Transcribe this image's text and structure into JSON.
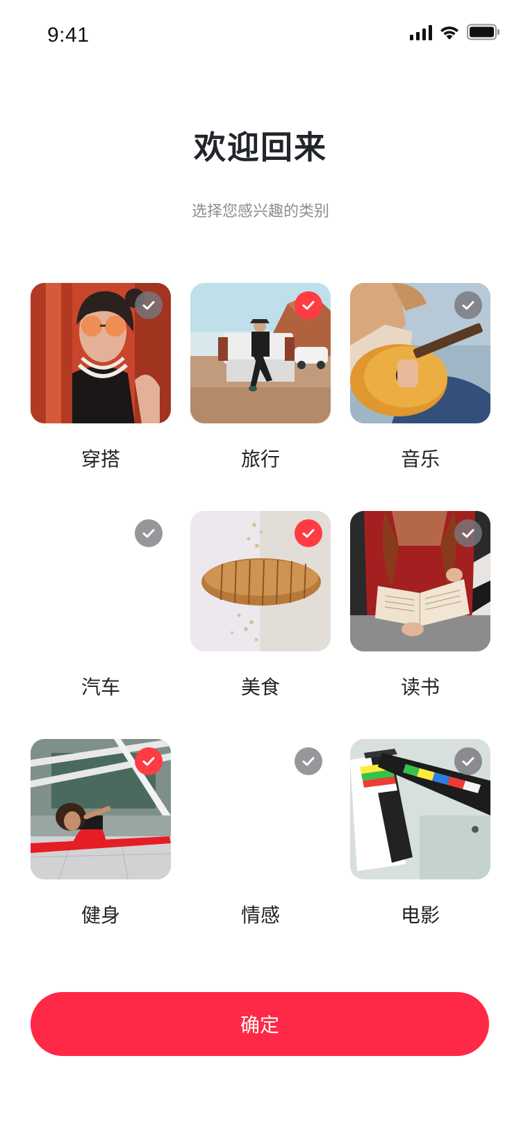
{
  "status_bar": {
    "time": "9:41",
    "icons": [
      "cellular-signal-icon",
      "wifi-icon",
      "battery-icon"
    ]
  },
  "header": {
    "title": "欢迎回来",
    "subtitle": "选择您感兴趣的类别"
  },
  "categories": [
    {
      "label": "穿搭",
      "selected": false,
      "image": "woman-sunglasses-photo"
    },
    {
      "label": "旅行",
      "selected": true,
      "image": "desert-truck-photo"
    },
    {
      "label": "音乐",
      "selected": false,
      "image": "guitar-photo"
    },
    {
      "label": "汽车",
      "selected": false,
      "image": null
    },
    {
      "label": "美食",
      "selected": true,
      "image": "bread-photo"
    },
    {
      "label": "读书",
      "selected": false,
      "image": "reading-book-photo"
    },
    {
      "label": "健身",
      "selected": true,
      "image": "stretching-photo"
    },
    {
      "label": "情感",
      "selected": false,
      "image": null
    },
    {
      "label": "电影",
      "selected": false,
      "image": "clapperboard-photo"
    }
  ],
  "confirm_button": {
    "label": "确定"
  },
  "colors": {
    "accent": "#ff2846",
    "check_selected": "#ff3b44",
    "check_unselected": "#8e8e92",
    "title": "#222529",
    "subtitle": "#8a8d93"
  }
}
